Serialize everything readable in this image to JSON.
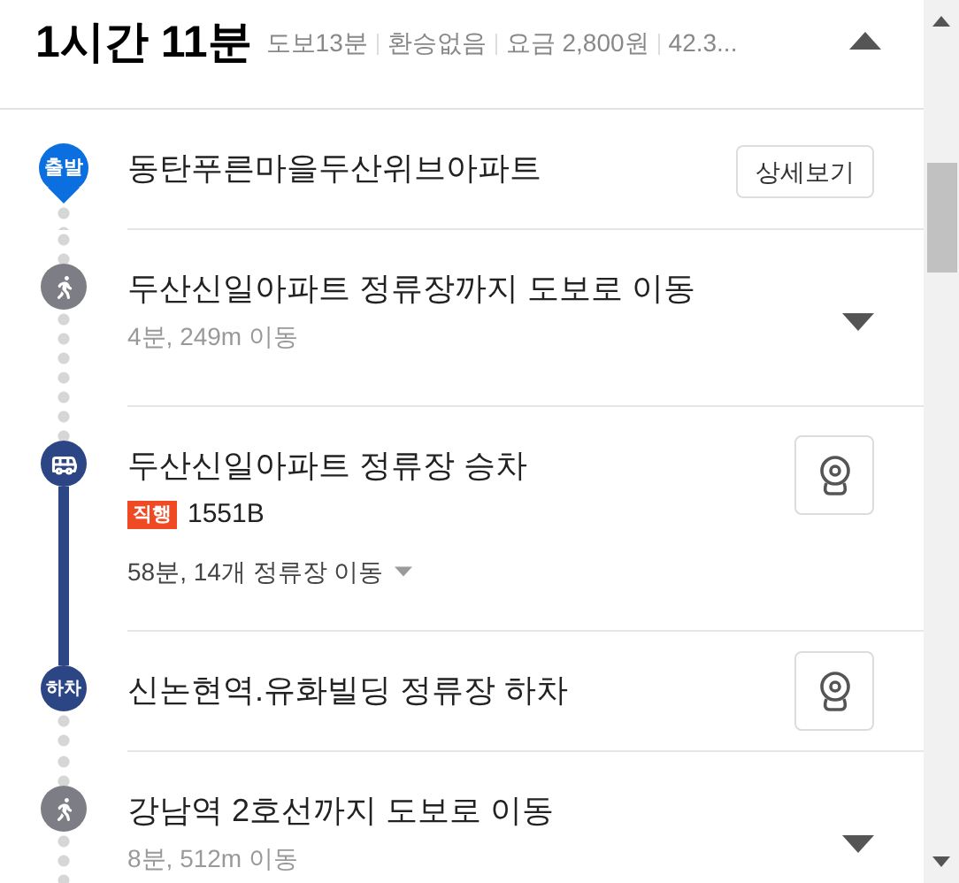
{
  "summary": {
    "time": "1시간 11분",
    "details": [
      "도보13분",
      "환승없음",
      "요금 2,800원",
      "42.3..."
    ],
    "expanded": true
  },
  "steps": [
    {
      "kind": "start",
      "marker": "출발",
      "title": "동탄푸른마을두산위브아파트",
      "button": "상세보기"
    },
    {
      "kind": "walk",
      "title": "두산신일아파트 정류장까지 도보로 이동",
      "subtitle": "4분, 249m 이동",
      "expanded": false
    },
    {
      "kind": "board",
      "title": "두산신일아파트 정류장 승차",
      "badge": "직행",
      "route": "1551B",
      "subtitle": "58분, 14개 정류장 이동",
      "expanded": false
    },
    {
      "kind": "alight",
      "marker": "하차",
      "title": "신논현역.유화빌딩 정류장 하차"
    },
    {
      "kind": "walk",
      "title": "강남역 2호선까지 도보로 이동",
      "subtitle": "8분, 512m 이동",
      "expanded": false
    }
  ]
}
